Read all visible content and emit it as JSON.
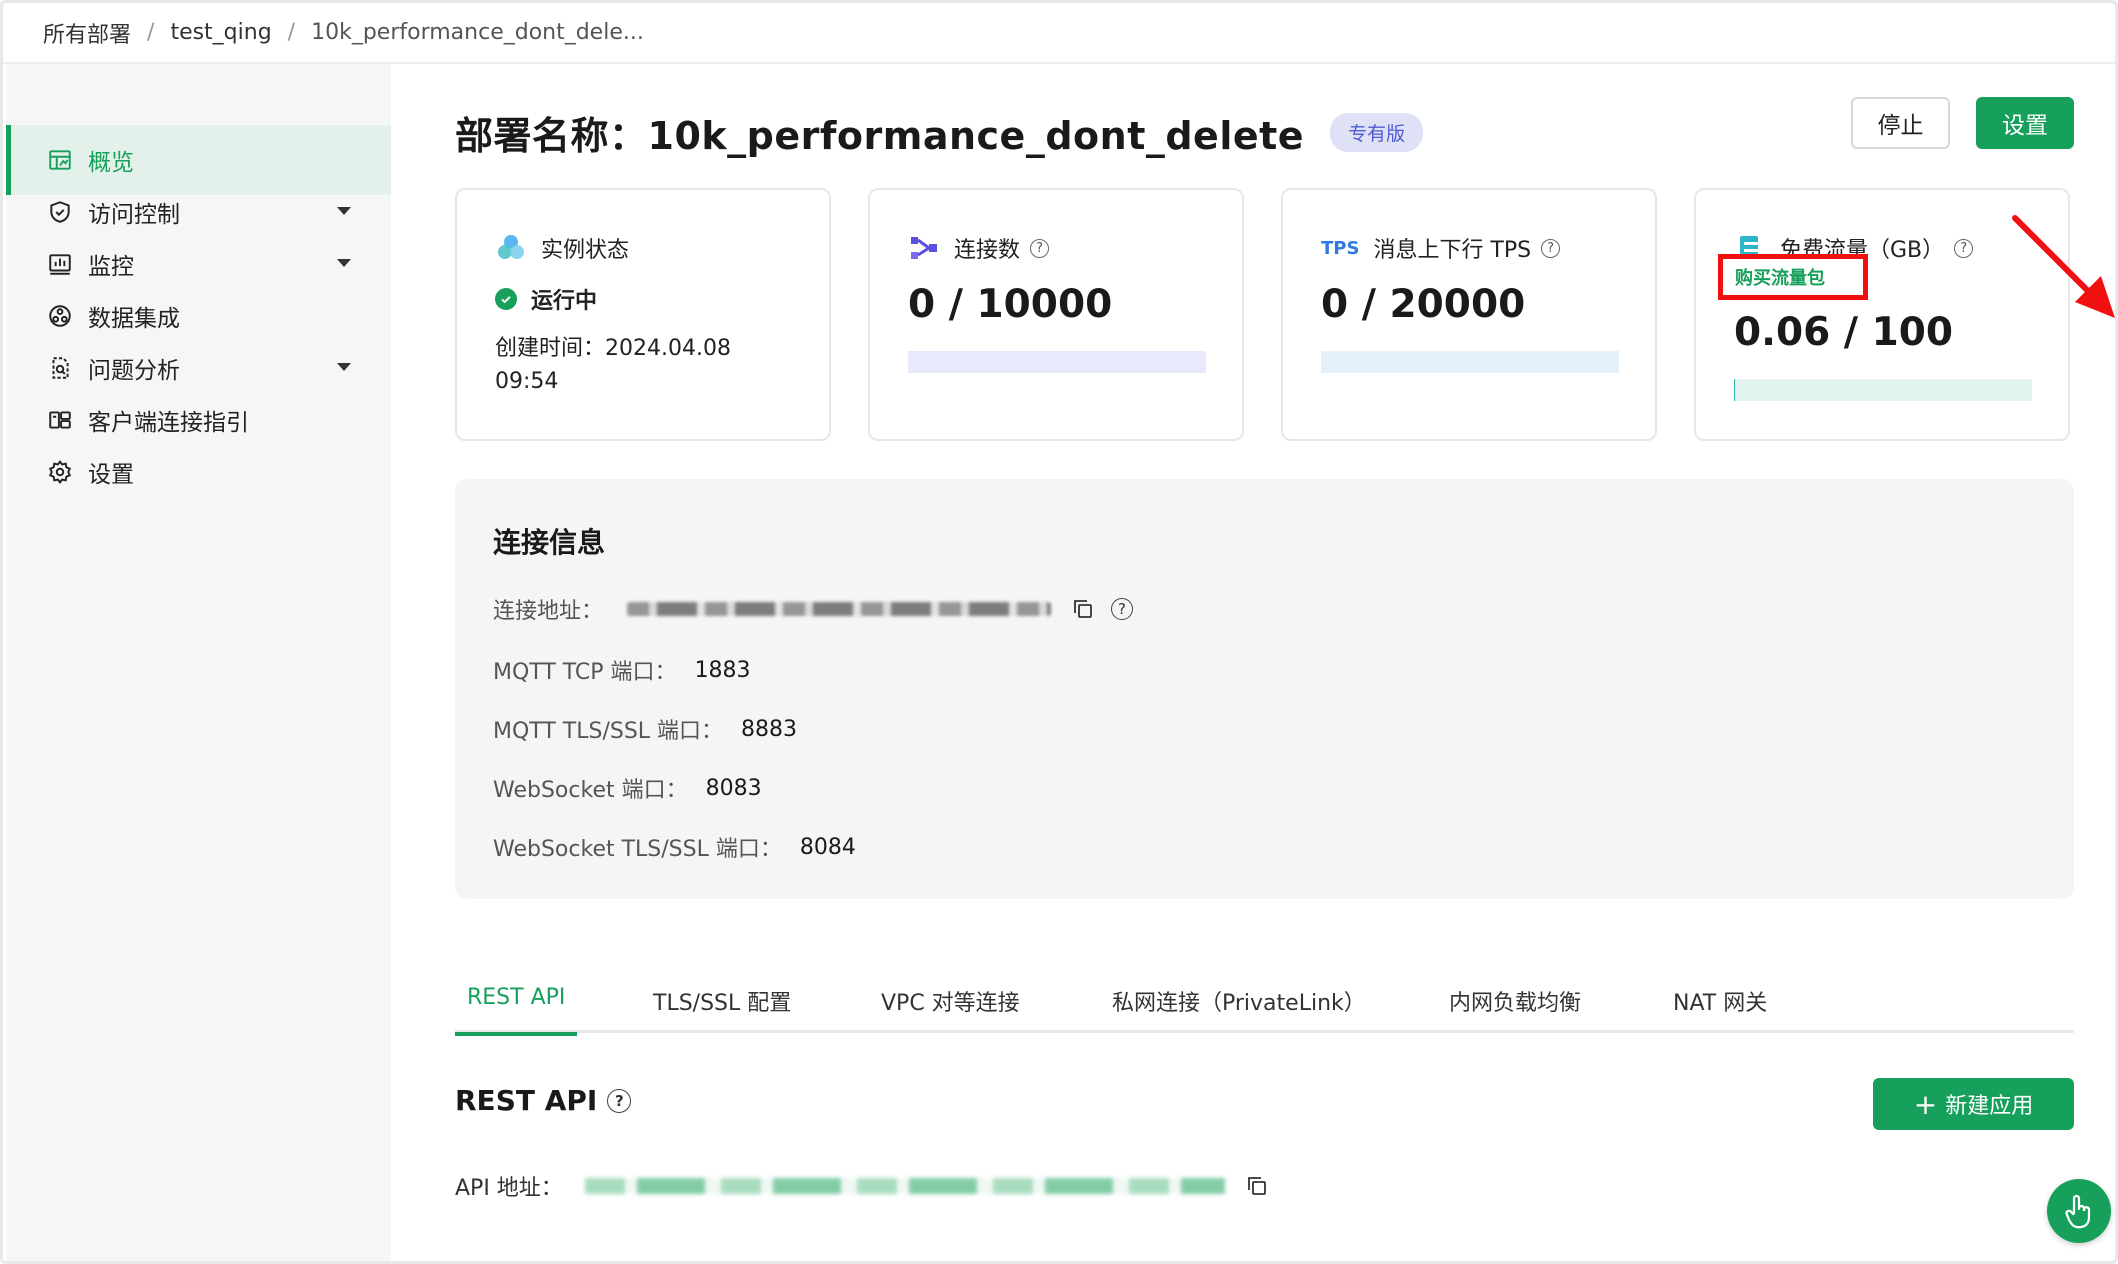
{
  "breadcrumb": [
    "所有部署",
    "test_qing",
    "10k_performance_dont_dele..."
  ],
  "sidebar": {
    "items": [
      {
        "label": "概览",
        "icon": "dashboard-icon",
        "active": true
      },
      {
        "label": "访问控制",
        "icon": "shield-icon",
        "expandable": true
      },
      {
        "label": "监控",
        "icon": "bar-chart-icon",
        "expandable": true
      },
      {
        "label": "数据集成",
        "icon": "integration-icon"
      },
      {
        "label": "问题分析",
        "icon": "document-search-icon",
        "expandable": true
      },
      {
        "label": "客户端连接指引",
        "icon": "client-guide-icon"
      },
      {
        "label": "设置",
        "icon": "gear-icon"
      }
    ]
  },
  "header": {
    "title": "部署名称：10k_performance_dont_delete",
    "badge": "专有版",
    "stop_label": "停止",
    "settings_label": "设置"
  },
  "cards": {
    "status": {
      "title": "实例状态",
      "state": "运行中",
      "created": "创建时间：2024.04.08 09:54"
    },
    "connections": {
      "title": "连接数",
      "value": "0 / 10000",
      "fraction": 0
    },
    "tps": {
      "title": "消息上下行 TPS",
      "prefix": "TPS",
      "value": "0 / 20000",
      "fraction": 0
    },
    "traffic": {
      "title": "免费流量（GB）",
      "buy_link": "购买流量包",
      "value": "0.06 / 100",
      "fraction": 0.0006
    }
  },
  "connection_info": {
    "title": "连接信息",
    "address_label": "连接地址：",
    "rows": [
      {
        "label": "MQTT TCP 端口：",
        "value": "1883"
      },
      {
        "label": "MQTT TLS/SSL 端口：",
        "value": "8883"
      },
      {
        "label": "WebSocket 端口：",
        "value": "8083"
      },
      {
        "label": "WebSocket TLS/SSL 端口：",
        "value": "8084"
      }
    ]
  },
  "tabs": [
    "REST API",
    "TLS/SSL 配置",
    "VPC 对等连接",
    "私网连接（PrivateLink）",
    "内网负载均衡",
    "NAT 网关"
  ],
  "rest_api": {
    "title": "REST API",
    "new_app_label": "新建应用",
    "address_label": "API 地址："
  },
  "colors": {
    "accent": "#17a05b",
    "annotation": "#f01010",
    "badge_bg": "#dfe1f7"
  }
}
